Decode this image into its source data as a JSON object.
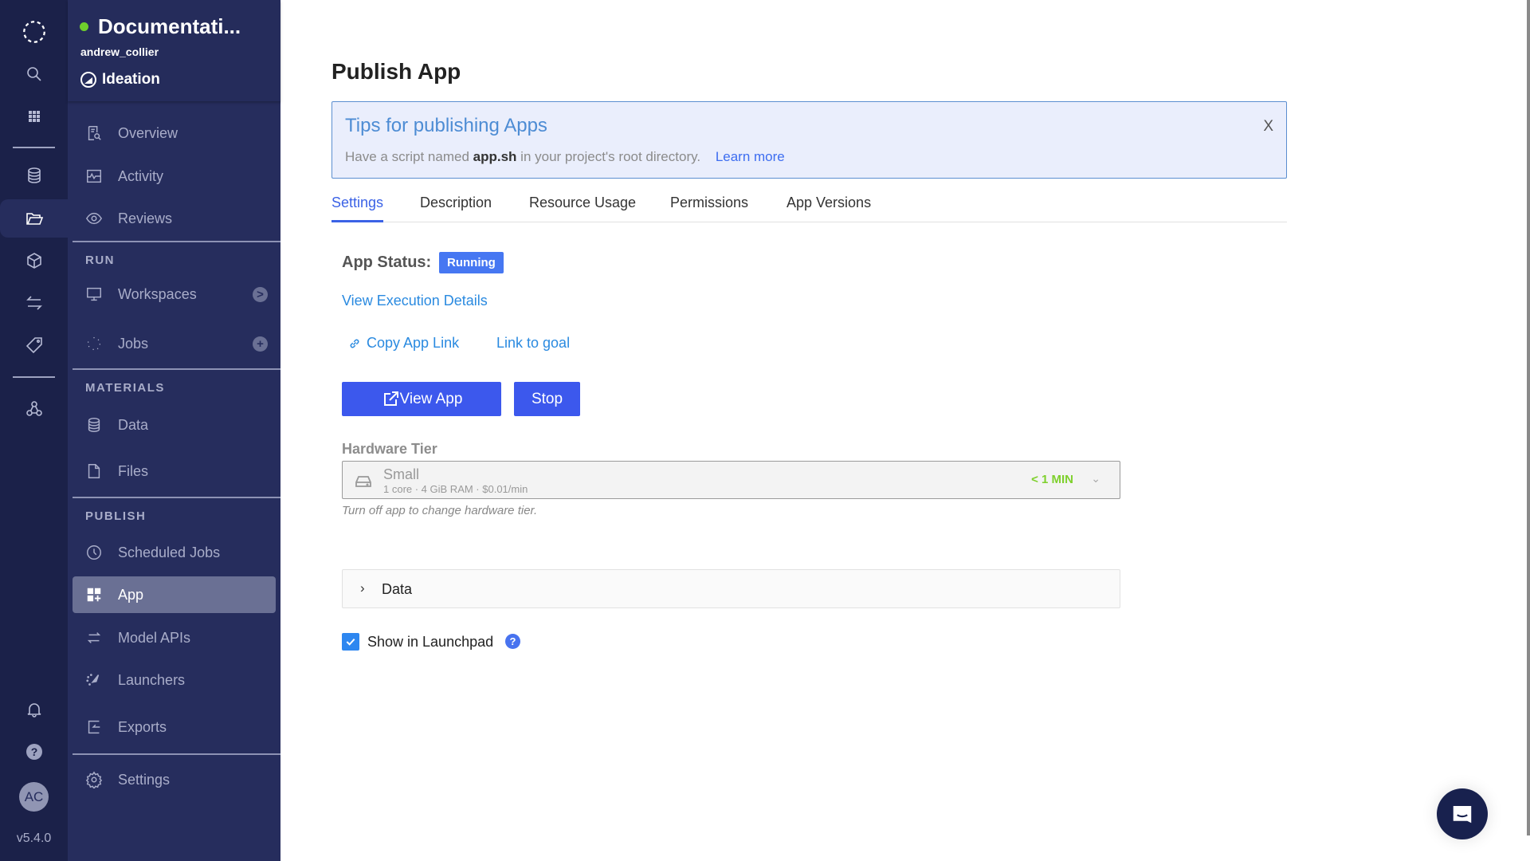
{
  "rail": {
    "icons": [
      "logo-icon",
      "search-icon",
      "apps-grid-icon",
      "database-icon",
      "folder-icon",
      "cube-icon",
      "transfer-icon",
      "tag-icon",
      "network-icon",
      "bell-icon",
      "help-icon"
    ],
    "avatar_initials": "AC",
    "version": "v5.4.0"
  },
  "project": {
    "name": "Documentati...",
    "owner": "andrew_collier",
    "stage": "Ideation",
    "status_color": "#6fd02c"
  },
  "nav": {
    "top": [
      {
        "label": "Overview",
        "icon": "overview-icon"
      },
      {
        "label": "Activity",
        "icon": "activity-icon"
      },
      {
        "label": "Reviews",
        "icon": "eye-icon"
      }
    ],
    "run_label": "RUN",
    "run": [
      {
        "label": "Workspaces",
        "icon": "monitor-icon",
        "badge": ">"
      },
      {
        "label": "Jobs",
        "icon": "jobs-icon",
        "badge": "+"
      }
    ],
    "materials_label": "MATERIALS",
    "materials": [
      {
        "label": "Data",
        "icon": "database-icon"
      },
      {
        "label": "Files",
        "icon": "file-icon"
      }
    ],
    "publish_label": "PUBLISH",
    "publish": [
      {
        "label": "Scheduled Jobs",
        "icon": "clock-icon"
      },
      {
        "label": "App",
        "icon": "app-icon",
        "active": true
      },
      {
        "label": "Model APIs",
        "icon": "arrows-icon"
      },
      {
        "label": "Launchers",
        "icon": "rocket-icon"
      },
      {
        "label": "Exports",
        "icon": "export-icon"
      }
    ],
    "settings": {
      "label": "Settings",
      "icon": "gear-icon"
    }
  },
  "page": {
    "title": "Publish App",
    "banner": {
      "title": "Tips for publishing Apps",
      "text_before": "Have a script named ",
      "text_bold": "app.sh",
      "text_after": " in your project's root directory.",
      "link": "Learn more",
      "close": "X"
    },
    "tabs": [
      "Settings",
      "Description",
      "Resource Usage",
      "Permissions",
      "App Versions"
    ],
    "active_tab": "Settings",
    "status_label": "App Status:",
    "status_value": "Running",
    "view_execution": "View Execution Details",
    "copy_link": "Copy App Link",
    "link_goal": "Link to goal",
    "view_app": "View App",
    "stop": "Stop",
    "hardware_label": "Hardware Tier",
    "hardware_name": "Small",
    "hardware_specs": "1 core · 4 GiB RAM · $0.01/min",
    "hardware_time": "< 1 MIN",
    "hardware_note": "Turn off app to change hardware tier.",
    "data_section": "Data",
    "launchpad_label": "Show in Launchpad",
    "launchpad_checked": true,
    "help": "?"
  },
  "colors": {
    "accent": "#3c58ed",
    "link": "#2a8ae0",
    "rail": "#1b2149",
    "sidebar": "#262d5d"
  }
}
